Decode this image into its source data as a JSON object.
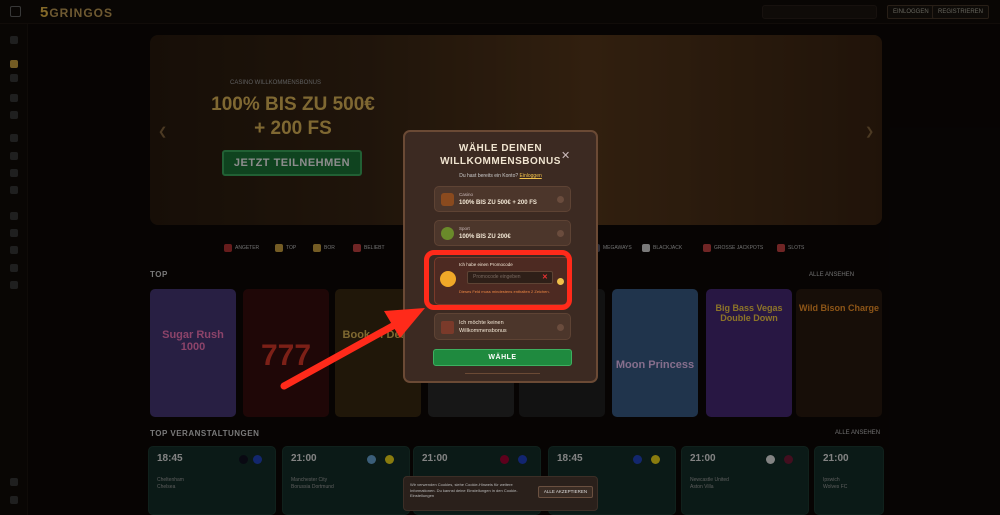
{
  "header": {
    "logo_number": "5",
    "logo_text": "GRINGOS",
    "login_label": "EINLOGGEN",
    "register_label": "REGISTRIEREN"
  },
  "hero": {
    "subtitle": "CASINO WILLKOMMENSBONUS",
    "title_line1": "100% BIS ZU 500€",
    "title_line2": "+ 200 FS",
    "cta": "JETZT TEILNEHMEN"
  },
  "categories": [
    {
      "label": "ANGETER"
    },
    {
      "label": "TOP"
    },
    {
      "label": "BOR"
    },
    {
      "label": "BELIEBT"
    },
    {
      "label": "MEGAWAYS"
    },
    {
      "label": "BLACKJACK"
    },
    {
      "label": "GROSSE JACKPOTS"
    },
    {
      "label": "SLOTS"
    }
  ],
  "top_section": {
    "title": "TOP",
    "see_all": "ALLE ANSEHEN"
  },
  "games": [
    {
      "name": "Sugar Rush 1000",
      "bg": "#4a3a7a",
      "fg": "#ff7ac0"
    },
    {
      "name": "777",
      "bg": "#3a0e0e",
      "fg": "#e23b2b"
    },
    {
      "name": "Book of Dead",
      "bg": "#3b2a12",
      "fg": "#e8c05a"
    },
    {
      "name": "",
      "bg": "#2a2a2a",
      "fg": "#ddd"
    },
    {
      "name": "",
      "bg": "#222",
      "fg": "#ddd"
    },
    {
      "name": "Moon Princess",
      "bg": "#3b5f8a",
      "fg": "#f3c9ff"
    },
    {
      "name": "Big Bass Vegas Double Down",
      "bg": "#4a2a7a",
      "fg": "#ffd34a"
    },
    {
      "name": "Wild Bison Charge",
      "bg": "#2a1a10",
      "fg": "#ff9a2a"
    }
  ],
  "events_section": {
    "title": "TOP VERANSTALTUNGEN",
    "see_all": "ALLE ANSEHEN"
  },
  "events": [
    {
      "time": "18:45",
      "team1": "Cheltenham",
      "team2": "Chelsea"
    },
    {
      "time": "21:00",
      "team1": "Manchester City",
      "team2": "Borussia Dortmund"
    },
    {
      "time": "21:00",
      "team1": "",
      "team2": ""
    },
    {
      "time": "18:45",
      "team1": "",
      "team2": ""
    },
    {
      "time": "21:00",
      "team1": "Newcastle United",
      "team2": "Aston Villa"
    },
    {
      "time": "21:00",
      "team1": "Ipswich",
      "team2": "Wolves FC"
    }
  ],
  "modal": {
    "title_line1": "WÄHLE DEINEN",
    "title_line2": "WILLKOMMENSBONUS",
    "login_prompt": "Du hast bereits ein Konto?",
    "login_link": "Einloggen",
    "options": [
      {
        "small": "Casino",
        "main": "100% BIS ZU 500€ + 200 FS",
        "icon": "chest-icon",
        "selected": false
      },
      {
        "small": "Sport",
        "main": "100% BIS ZU 200€",
        "icon": "ball-icon",
        "selected": false
      },
      {
        "small": "Ich habe einen Promocode",
        "main": "",
        "icon": "promo-icon",
        "selected": true
      },
      {
        "small": "",
        "main": "Ich möchte keinen Willkommensbonus",
        "icon": "no-bonus-icon",
        "selected": false
      }
    ],
    "promo_placeholder": "Promocode eingeben",
    "promo_error": "Dieses Feld muss mindestens enthalten 2 Zeichen.",
    "choose_button": "WÄHLE"
  },
  "cookie": {
    "text": "Wir verwenden Cookies, siehe Cookie-Hinweis für weitere Informationen. Du kannst deine Einstellungen in den Cookie-Einstellungen",
    "accept": "ALLE AKZEPTIEREN"
  },
  "colors": {
    "accent": "#f0c04a",
    "primary_green": "#1f8a3f",
    "highlight_red": "#ff2a1a",
    "modal_bg": "#3c2a22"
  }
}
